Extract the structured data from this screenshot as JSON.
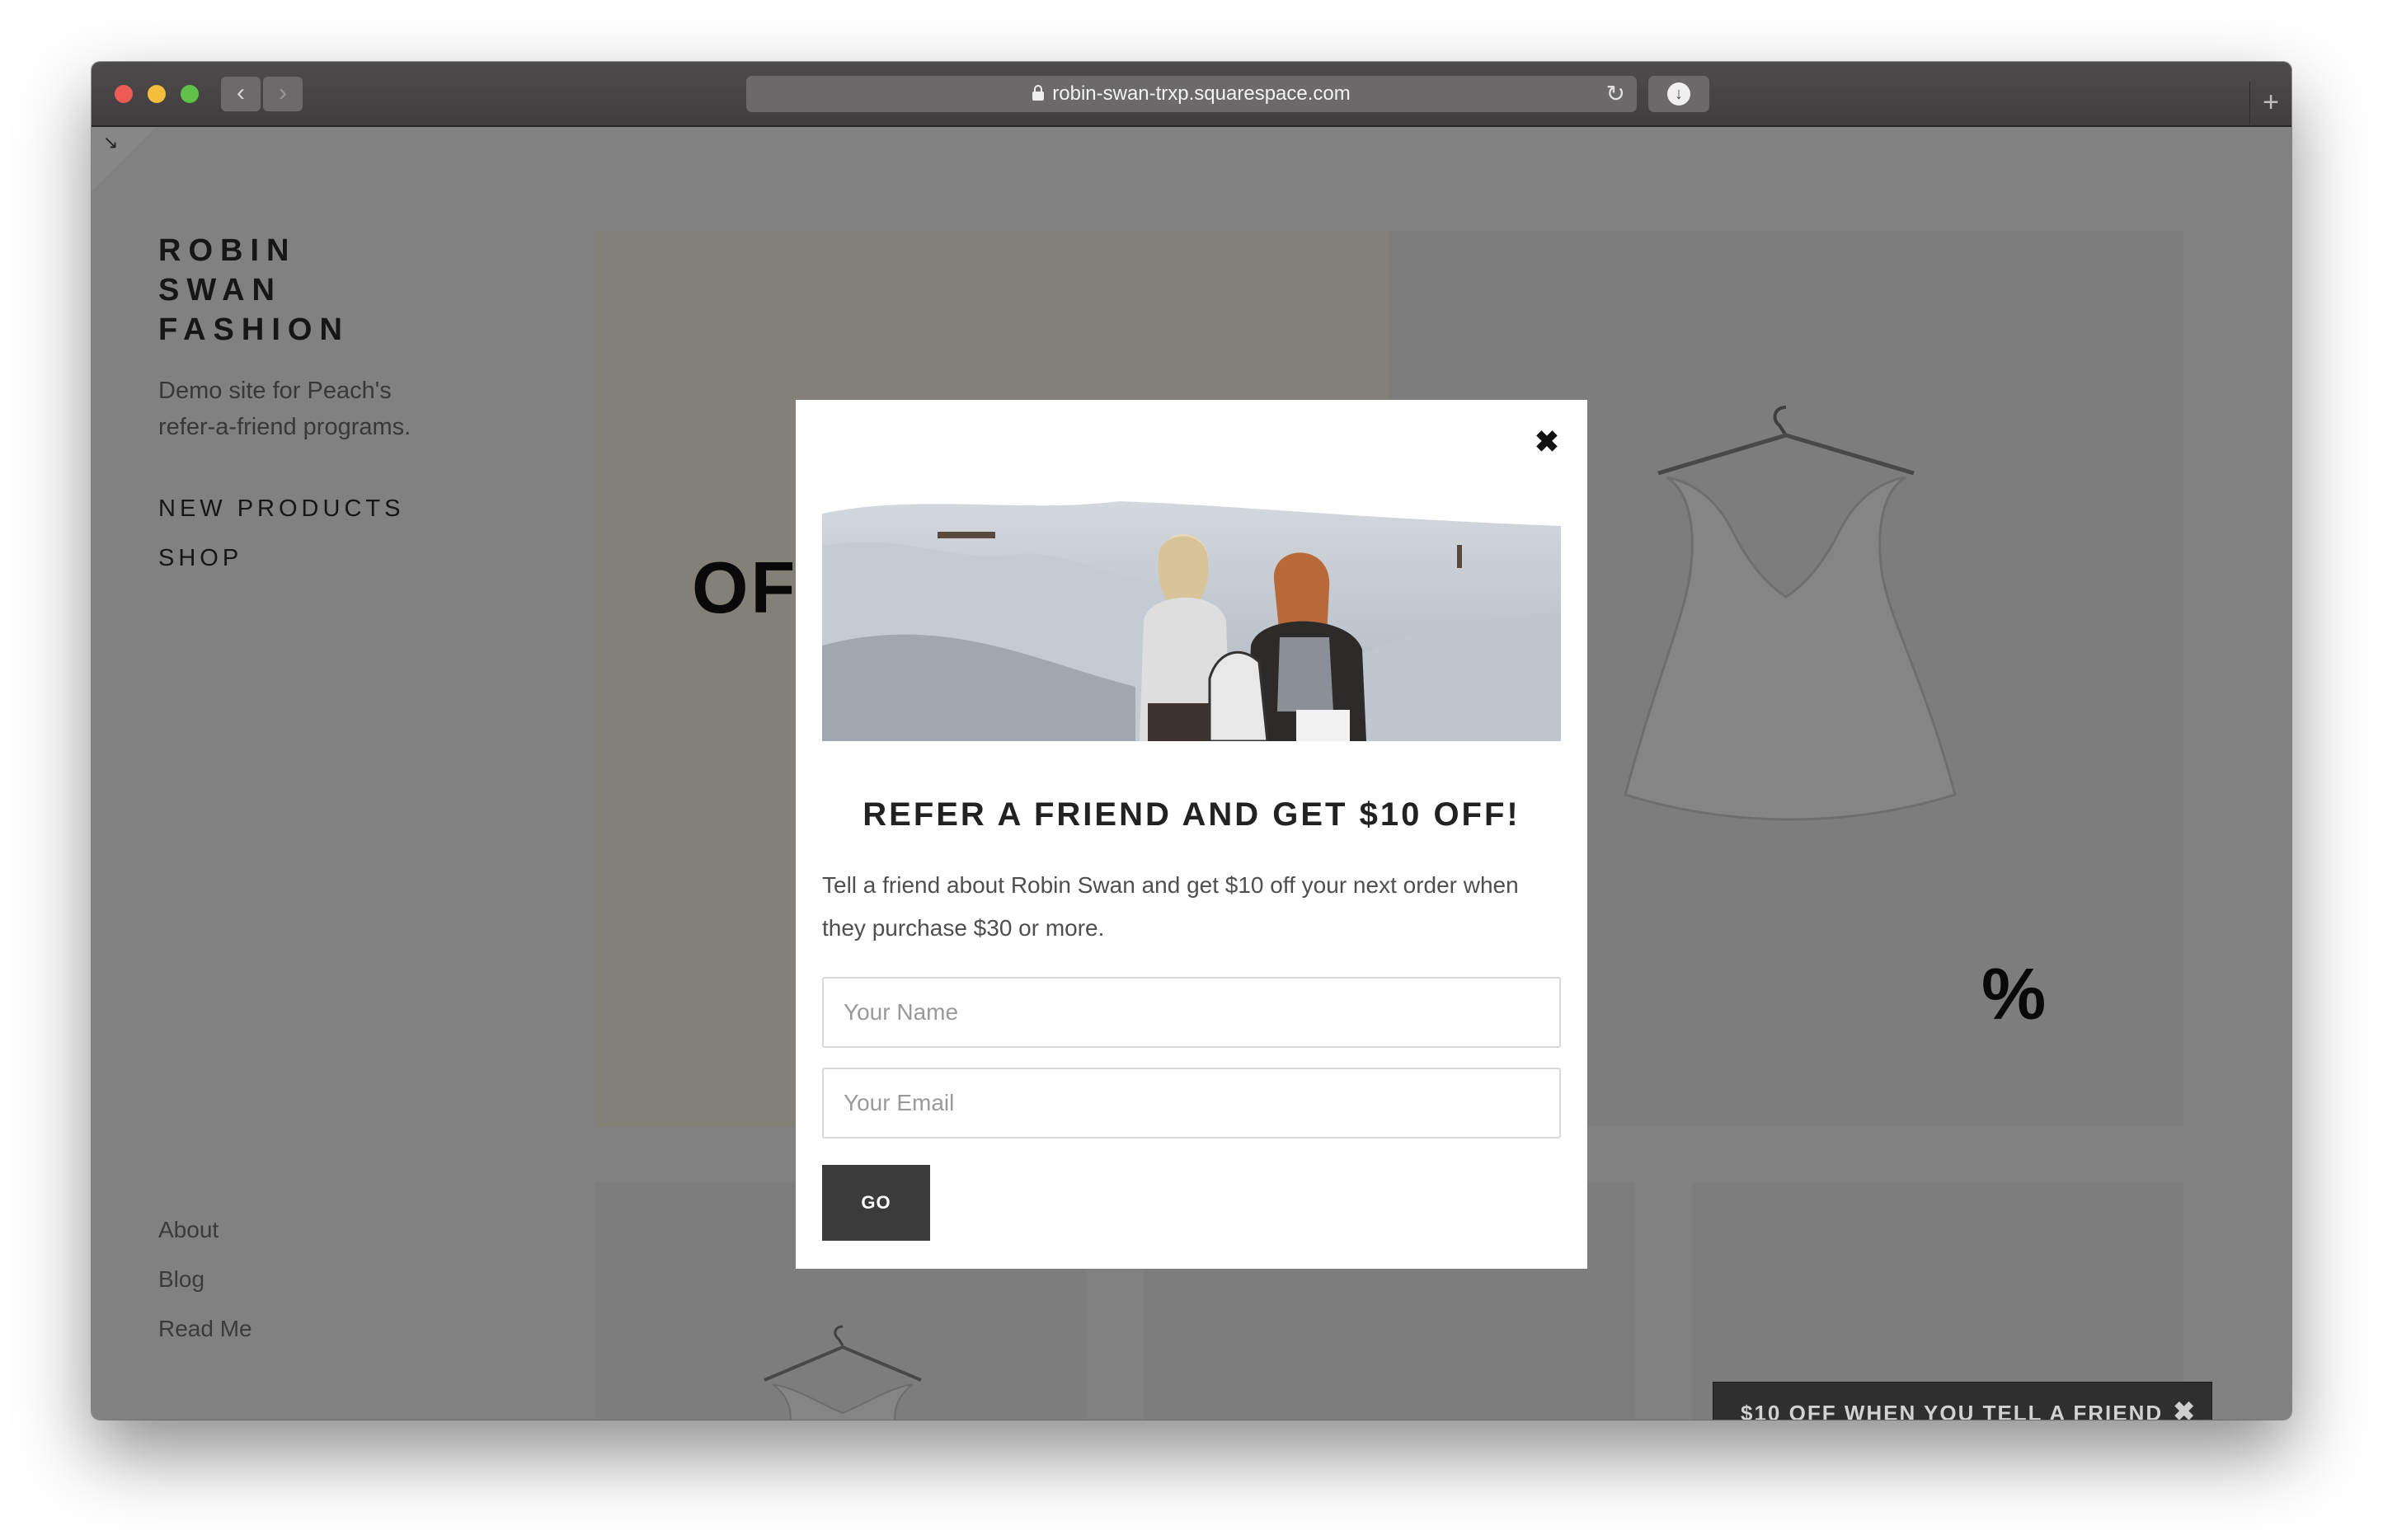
{
  "browser": {
    "url": "robin-swan-trxp.squarespace.com",
    "back_icon": "‹",
    "forward_icon": "›",
    "reload_icon": "↻",
    "download_icon": "↓",
    "new_tab_icon": "+"
  },
  "site": {
    "title_lines": [
      "ROBIN",
      "SWAN",
      "FASHION"
    ],
    "tagline": "Demo site for Peach's refer-a-friend programs.",
    "nav": [
      "NEW PRODUCTS",
      "SHOP"
    ],
    "footer_links": [
      "About",
      "Blog",
      "Read Me"
    ],
    "banner_text": "OF",
    "percent_text": "%",
    "corner_icon": "↘"
  },
  "modal": {
    "close_icon": "✖",
    "title": "REFER A FRIEND AND GET $10 OFF!",
    "description": "Tell a friend about Robin Swan and get $10 off your next order when they purchase $30 or more.",
    "name_placeholder": "Your Name",
    "email_placeholder": "Your Email",
    "submit_label": "GO"
  },
  "refer_tab": {
    "label": "$10 OFF WHEN YOU TELL A FRIEND",
    "close_icon": "✖"
  },
  "colors": {
    "banner_left": "#f7f2e0",
    "overlay": "rgba(0,0,0,0.47)",
    "button_dark": "#3b3b3b",
    "tab_dark": "#2f2f2f"
  }
}
